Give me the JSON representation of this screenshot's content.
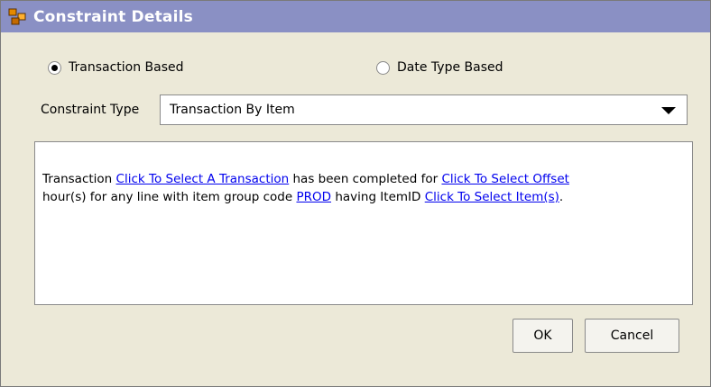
{
  "window": {
    "title": "Constraint Details",
    "icon": "constraint-icon"
  },
  "radios": [
    {
      "label": "Transaction Based",
      "selected": true
    },
    {
      "label": "Date Type Based",
      "selected": false
    }
  ],
  "constraint_type": {
    "label": "Constraint Type",
    "value": "Transaction By Item"
  },
  "description": {
    "t1": "Transaction ",
    "link1": "Click To Select A Transaction",
    "t2": " has been completed for ",
    "link2": "Click To Select Offset",
    "t3": "hour(s) for any line with item group code ",
    "link3": "PROD",
    "t4": " having ItemID ",
    "link4": "Click To Select Item(s)",
    "t5": "."
  },
  "buttons": {
    "ok": "OK",
    "cancel": "Cancel"
  },
  "colors": {
    "titlebar": "#8a90c4",
    "link": "#0000ee"
  }
}
